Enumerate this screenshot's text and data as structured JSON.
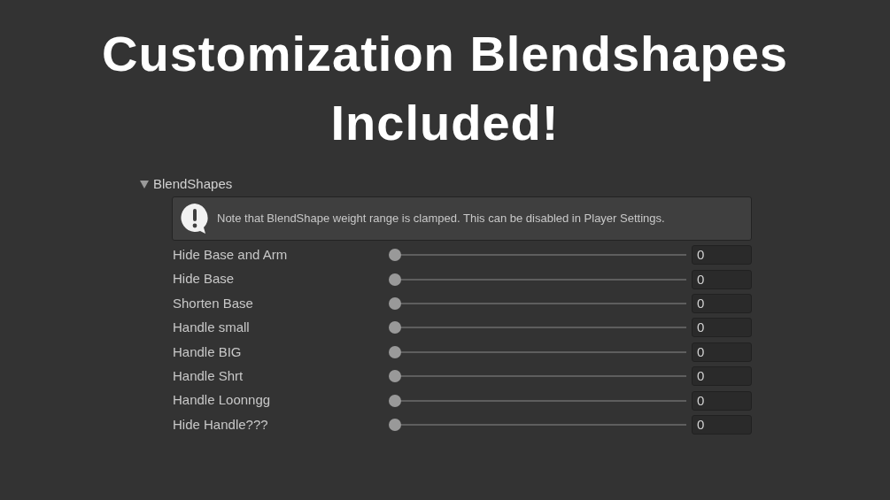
{
  "headline": [
    "Customization Blendshapes",
    "Included!"
  ],
  "foldout": {
    "label": "BlendShapes",
    "expanded": true
  },
  "help_box": {
    "message": "Note that BlendShape weight range is clamped. This can be disabled in Player Settings."
  },
  "sliders": [
    {
      "label": "Hide Base and Arm",
      "level": 0,
      "value": "0"
    },
    {
      "label": "Hide Base",
      "level": 0,
      "value": "0"
    },
    {
      "label": "Shorten Base",
      "level": 0,
      "value": "0"
    },
    {
      "label": "Handle small",
      "level": 0,
      "value": "0"
    },
    {
      "label": "Handle BIG",
      "level": 0,
      "value": "0"
    },
    {
      "label": "Handle Shrt",
      "level": 0,
      "value": "0"
    },
    {
      "label": "Handle Loonngg",
      "level": 0,
      "value": "0"
    },
    {
      "label": "Hide Handle???",
      "level": 0,
      "value": "0"
    }
  ]
}
